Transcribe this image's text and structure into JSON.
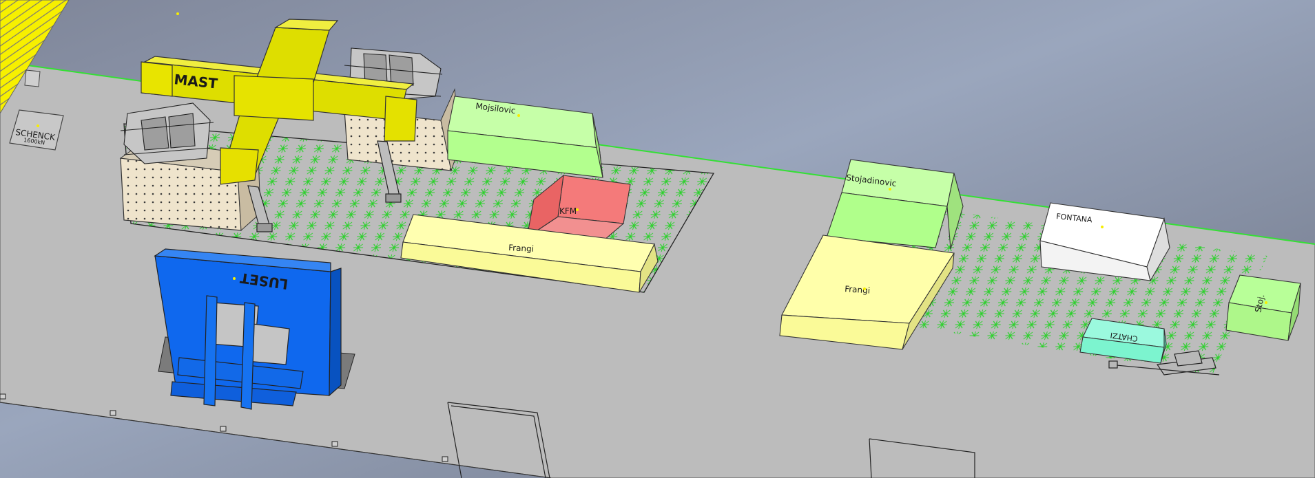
{
  "scene": {
    "background_top": "#8f9aae",
    "background_bottom": "#dfe3e8",
    "floor_color": "#bdbdbd",
    "edge_line_color": "#33dd33",
    "grid_pattern_color": "#27c827"
  },
  "labels": {
    "mast": "MAST",
    "schenck_line1": "SCHENCK",
    "schenck_line2": "1600kN",
    "mojsilovic": "Mojsilovic",
    "kfm": "KFM",
    "frangi_left": "Frangi",
    "luset": "LUSET",
    "stojadinovic": "Stojadinovic",
    "frangi_right": "Frangi",
    "fontana": "FONTANA",
    "chatzi": "CHATZI",
    "stoj": "Stoj."
  },
  "colors": {
    "yellow_frame": "#dcd800",
    "green_box": "#b2ff8a",
    "red_box": "#f47a7a",
    "light_yellow_box": "#ffffa8",
    "blue_frame": "#0a63e8",
    "white_box": "#ffffff",
    "cyan_box": "#7cf4cf"
  }
}
